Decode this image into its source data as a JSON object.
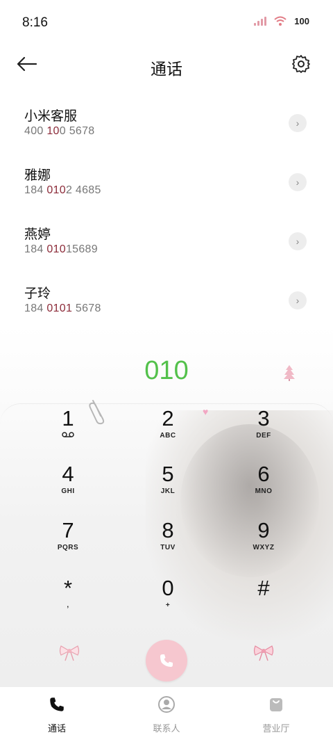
{
  "status_bar": {
    "time": "8:16",
    "battery": "100"
  },
  "header": {
    "title": "通话"
  },
  "contacts": [
    {
      "name": "小米客服",
      "number_pre": "400 ",
      "number_hl": "10",
      "number_post": "0 5678"
    },
    {
      "name": "雅娜",
      "number_pre": "184 ",
      "number_hl": "010",
      "number_post": "2 4685"
    },
    {
      "name": "燕婷",
      "number_pre": "184 ",
      "number_hl": "010",
      "number_post": "15689"
    },
    {
      "name": "子玲",
      "number_pre": "184 ",
      "number_hl": "0101",
      "number_post": " 5678"
    }
  ],
  "dialer": {
    "value": "010",
    "keys": [
      {
        "digit": "1",
        "letters": ""
      },
      {
        "digit": "2",
        "letters": "ABC"
      },
      {
        "digit": "3",
        "letters": "DEF"
      },
      {
        "digit": "4",
        "letters": "GHI"
      },
      {
        "digit": "5",
        "letters": "JKL"
      },
      {
        "digit": "6",
        "letters": "MNO"
      },
      {
        "digit": "7",
        "letters": "PQRS"
      },
      {
        "digit": "8",
        "letters": "TUV"
      },
      {
        "digit": "9",
        "letters": "WXYZ"
      },
      {
        "digit": "*",
        "letters": ","
      },
      {
        "digit": "0",
        "letters": "+"
      },
      {
        "digit": "#",
        "letters": ""
      }
    ]
  },
  "nav": {
    "calls": "通话",
    "contacts": "联系人",
    "store": "营业厅"
  },
  "colors": {
    "dial_value": "#53c14b",
    "highlight": "#8c2b39",
    "call_button": "#f6c7cf"
  }
}
